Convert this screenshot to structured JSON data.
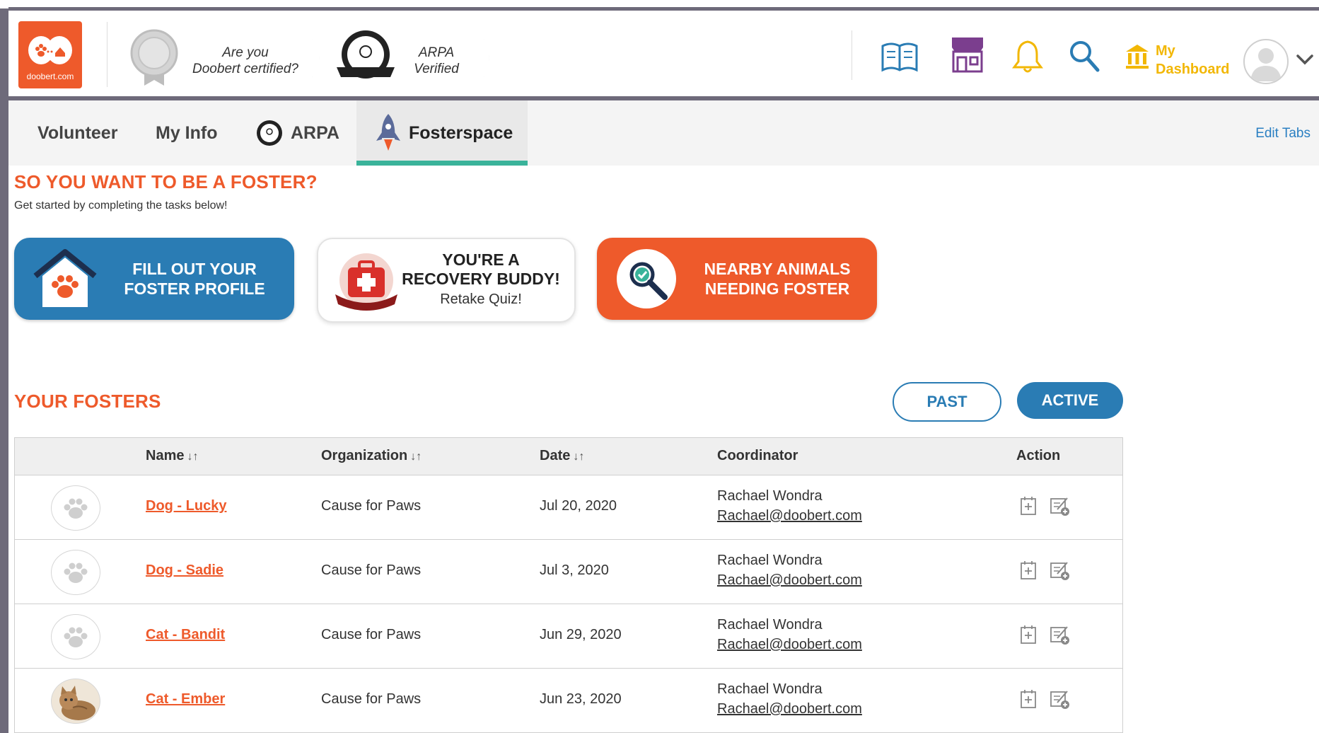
{
  "header": {
    "logo_text": "doobert.com",
    "badges": [
      {
        "line1": "Are you",
        "line2": "Doobert certified?"
      },
      {
        "line1": "ARPA",
        "line2": "Verified"
      }
    ],
    "icons": [
      "book-icon",
      "store-icon",
      "bell-icon",
      "search-icon",
      "dashboard-icon"
    ],
    "dashboard_line1": "My",
    "dashboard_line2": "Dashboard"
  },
  "tabs": {
    "items": [
      {
        "label": "Volunteer"
      },
      {
        "label": "My Info"
      },
      {
        "label": "ARPA"
      },
      {
        "label": "Fosterspace"
      }
    ],
    "active": "Fosterspace",
    "edit_label": "Edit Tabs"
  },
  "intro": {
    "title": "SO YOU WANT TO BE A FOSTER?",
    "subtitle": "Get started by completing the tasks below!"
  },
  "cards": {
    "profile_line1": "FILL OUT YOUR",
    "profile_line2": "FOSTER PROFILE",
    "buddy_line1": "YOU'RE A",
    "buddy_line2": "RECOVERY BUDDY!",
    "buddy_sub": "Retake Quiz!",
    "nearby_line1": "NEARBY ANIMALS",
    "nearby_line2": "NEEDING FOSTER",
    "buddy_badge_text": "Recovery Buddy"
  },
  "fosters": {
    "title": "YOUR FOSTERS",
    "past_label": "PAST",
    "active_label": "ACTIVE",
    "columns": {
      "name": "Name",
      "organization": "Organization",
      "date": "Date",
      "coordinator": "Coordinator",
      "action": "Action",
      "sort_glyph": "↓↑"
    },
    "rows": [
      {
        "name": "Dog - Lucky",
        "org": "Cause for Paws",
        "date": "Jul 20, 2020",
        "coord_name": "Rachael Wondra",
        "coord_email": "Rachael@doobert.com",
        "photo": "paw-placeholder"
      },
      {
        "name": "Dog - Sadie",
        "org": "Cause for Paws",
        "date": "Jul 3, 2020",
        "coord_name": "Rachael Wondra",
        "coord_email": "Rachael@doobert.com",
        "photo": "paw-placeholder"
      },
      {
        "name": "Cat - Bandit",
        "org": "Cause for Paws",
        "date": "Jun 29, 2020",
        "coord_name": "Rachael Wondra",
        "coord_email": "Rachael@doobert.com",
        "photo": "paw-placeholder"
      },
      {
        "name": "Cat - Ember",
        "org": "Cause for Paws",
        "date": "Jun 23, 2020",
        "coord_name": "Rachael Wondra",
        "coord_email": "Rachael@doobert.com",
        "photo": "cat-photo"
      }
    ]
  },
  "colors": {
    "brand_orange": "#ee5a2b",
    "brand_blue": "#2a7cb4",
    "accent_yellow": "#f2b705",
    "tab_underline": "#3ab39a",
    "store_purple": "#7b3e8e"
  }
}
